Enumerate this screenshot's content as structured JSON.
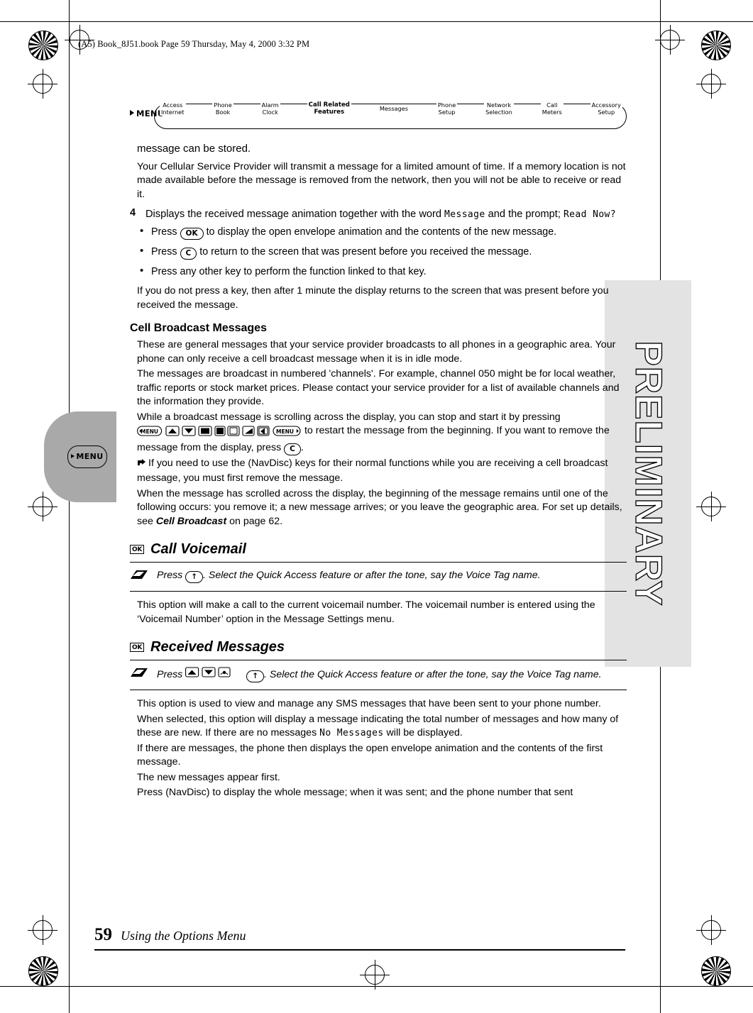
{
  "header": {
    "running_head": "(A5) Book_8J51.book  Page 59  Thursday, May 4, 2000  3:32 PM"
  },
  "menu_path": {
    "menu_label": "MENU",
    "steps": [
      {
        "label": "Access\nInternet",
        "current": false
      },
      {
        "label": "Phone\nBook",
        "current": false
      },
      {
        "label": "Alarm\nClock",
        "current": false
      },
      {
        "label": "Call Related\nFeatures",
        "current": true
      },
      {
        "label": "Messages",
        "current": false
      },
      {
        "label": "Phone\nSetup",
        "current": false
      },
      {
        "label": "Network\nSelection",
        "current": false
      },
      {
        "label": "Call\nMeters",
        "current": false
      },
      {
        "label": "Accessory\nSetup",
        "current": false
      }
    ]
  },
  "body": {
    "continued_line": "message can be stored.",
    "para_provider": "Your Cellular Service Provider will transmit a message for a limited amount of time. If a memory location is not made available before the message is removed from the network, then you will not be able to receive or read it.",
    "step4": {
      "number": "4",
      "text_a": "Displays the received message animation together with the word ",
      "word": "Message",
      "text_b": " and the prompt; ",
      "prompt": "Read Now?"
    },
    "bullets": [
      {
        "pre": "Press ",
        "key": "OK",
        "post": " to display the open envelope animation and the contents of the new message."
      },
      {
        "pre": "Press ",
        "key": "C",
        "post": " to return to the screen that was present before you received the message."
      },
      {
        "pre": "Press any other key to perform the function linked to that key.",
        "key": "",
        "post": ""
      }
    ],
    "para_nopress": "If you do not press a key, then after 1 minute the display returns to the screen that was present before you received the message.",
    "cell_broadcast_heading": "Cell Broadcast Messages",
    "cb_para1": "These are general messages that your service provider broadcasts to all phones in a geographic area. Your phone can only receive a cell broadcast message when it is in idle mode.",
    "cb_para2": "The messages are broadcast in numbered 'channels'. For example, channel 050 might be for local weather, traffic reports or stock market prices. Please contact your service provider for a list of available channels and the information they provide.",
    "cb_para3_a": "While a broadcast message is scrolling across the display, you can stop and start it by pressing ",
    "cb_para3_b": " to restart the message from the beginning. If you want to remove the message from the display, press ",
    "cb_para3_key": "C",
    "cb_para3_c": ".",
    "cb_note": "If you need to use the (NavDisc) keys for their normal functions while you are receiving a cell broadcast message, you must first remove the message.",
    "cb_para4_a": "When the message has scrolled across the display, the beginning of the message remains until one of the following occurs: you remove it; a new message arrives; or you leave the geographic area. For set up details, see ",
    "cb_para4_ref": "Cell Broadcast",
    "cb_para4_b": " on page 62."
  },
  "call_voicemail": {
    "title": "Call Voicemail",
    "icon": "ok-key-icon",
    "quick_access": {
      "pre": "Press ",
      "key_glyph": "↑",
      "post": ". Select the Quick Access feature or after the tone, say the Voice Tag name."
    },
    "para": "This option will make a call to the current voicemail number. The voicemail number is entered using the ‘Voicemail Number’ option in the Message Settings menu."
  },
  "received_messages": {
    "title": "Received Messages",
    "icon": "ok-key-icon",
    "quick_access": {
      "pre": "Press ",
      "key_glyph": "↑",
      "post": ". Select the Quick Access feature or after the tone, say the Voice Tag name."
    },
    "para1": "This option is used to view and manage any SMS messages that have been sent to your phone number.",
    "para2_a": "When selected, this option will display a message indicating the total number of messages and how many of these are new. If there are no messages ",
    "para2_mono": "No Messages",
    "para2_b": " will be displayed.",
    "para3": "If there are messages, the phone then displays the open envelope animation and the contents of the first message.",
    "para4": "The new messages appear first.",
    "para5": "Press (NavDisc) to display the whole message; when it was sent; and the phone number that sent"
  },
  "watermark": {
    "text": "PRELIMINARY"
  },
  "side_tab": {
    "label": "MENU"
  },
  "footer": {
    "page_number": "59",
    "title": "Using the Options Menu"
  }
}
